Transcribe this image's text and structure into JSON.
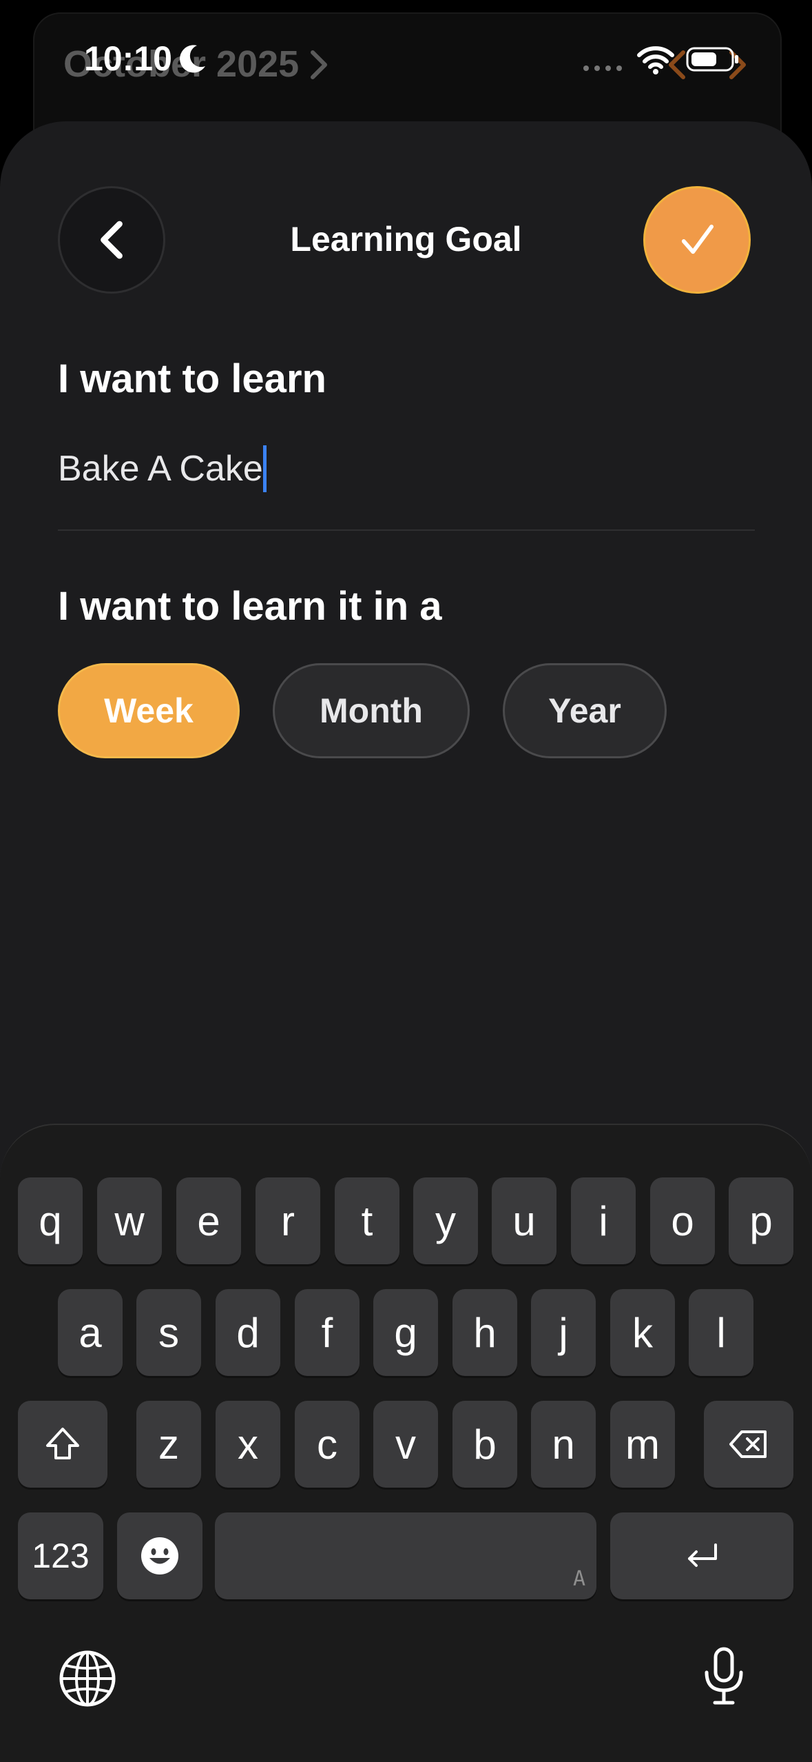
{
  "background": {
    "month_label": "October 2025"
  },
  "status_bar": {
    "time": "10:10"
  },
  "header": {
    "title": "Learning Goal"
  },
  "form": {
    "learn_label": "I want to learn",
    "learn_value": "Bake A Cake",
    "period_label": "I want to learn it in a",
    "period_options": [
      "Week",
      "Month",
      "Year"
    ],
    "selected_period": "Week"
  },
  "keyboard": {
    "row1": [
      "q",
      "w",
      "e",
      "r",
      "t",
      "y",
      "u",
      "i",
      "o",
      "p"
    ],
    "row2": [
      "a",
      "s",
      "d",
      "f",
      "g",
      "h",
      "j",
      "k",
      "l"
    ],
    "row3": [
      "z",
      "x",
      "c",
      "v",
      "b",
      "n",
      "m"
    ],
    "numbers_key": "123",
    "space_mark": "A"
  },
  "colors": {
    "accent": "#f2a844",
    "confirm": "#f09a48",
    "sheet": "#1c1c1e",
    "caret": "#3b82f6"
  },
  "icons": {
    "back": "chevron-left-icon",
    "confirm": "checkmark-icon",
    "shift": "shift-icon",
    "delete": "backspace-icon",
    "emoji": "emoji-icon",
    "return": "return-icon",
    "globe": "globe-icon",
    "mic": "microphone-icon"
  }
}
